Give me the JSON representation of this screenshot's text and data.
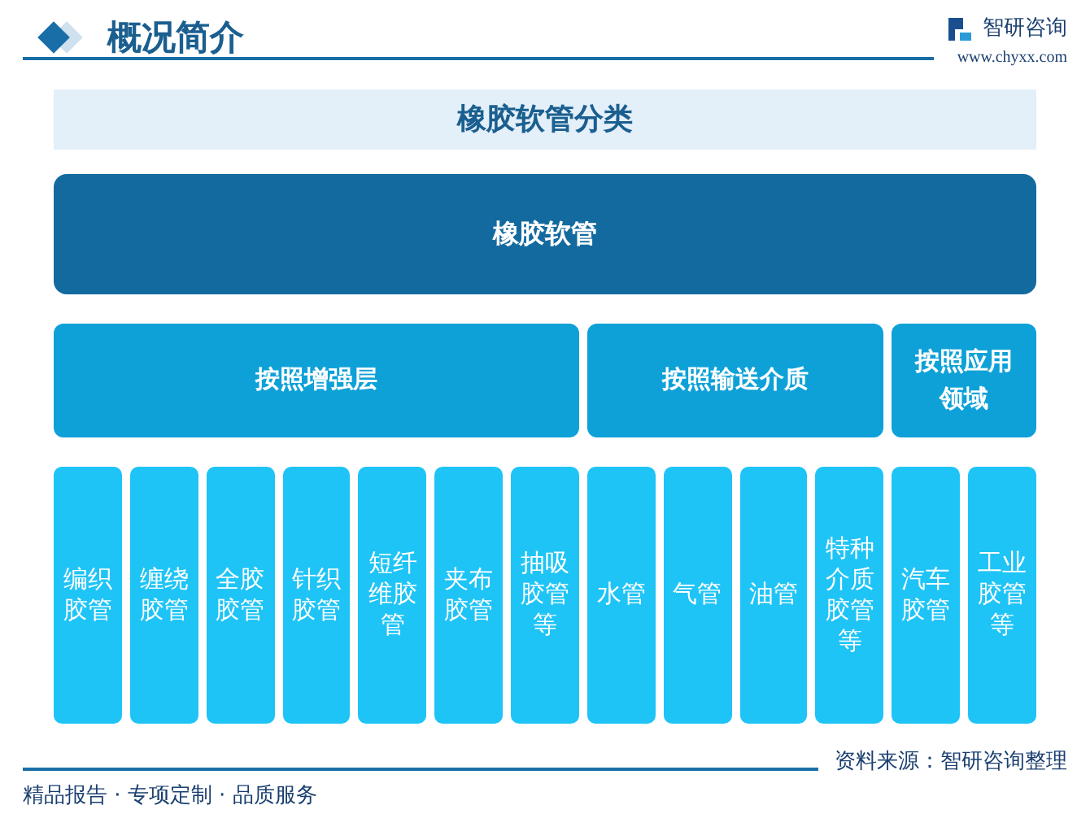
{
  "header": {
    "title": "概况简介",
    "brand": "智研咨询",
    "url": "www.chyxx.com"
  },
  "chart_title": "橡胶软管分类",
  "root": "橡胶软管",
  "categories": [
    {
      "label": "按照增强层",
      "children": [
        "编织胶管",
        "缠绕胶管",
        "全胶胶管",
        "针织胶管",
        "短纤维胶管",
        "夹布胶管",
        "抽吸胶管等"
      ]
    },
    {
      "label": "按照输送介质",
      "children": [
        "水管",
        "气管",
        "油管",
        "特种介质胶管等"
      ]
    },
    {
      "label": "按照应用领域",
      "children": [
        "汽车胶管",
        "工业胶管等"
      ]
    }
  ],
  "footer": {
    "source": "资料来源：智研咨询整理",
    "slogan": "精品报告 · 专项定制 · 品质服务"
  }
}
